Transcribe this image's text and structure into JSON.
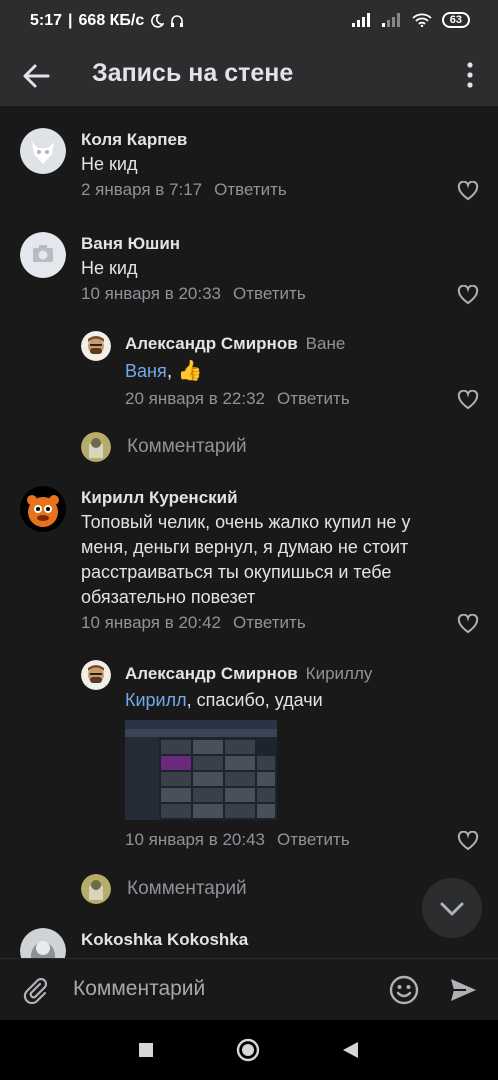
{
  "status_bar": {
    "time": "5:17",
    "speed": "668 КБ/с",
    "battery": "63"
  },
  "header": {
    "title": "Запись на стене"
  },
  "comments": [
    {
      "author": "Коля Карпев",
      "text": "Не кид",
      "date": "2 января в 7:17",
      "reply": "Ответить"
    },
    {
      "author": "Ваня Юшин",
      "text": "Не кид",
      "date": "10 января в 20:33",
      "reply": "Ответить"
    },
    {
      "author": "Александр Смирнов",
      "reply_to": "Ване",
      "mention": "Ваня",
      "text": ", 👍",
      "date": "20 января в 22:32",
      "reply": "Ответить"
    },
    {
      "author": "Кирилл Куренский",
      "text_lines": [
        "Топовый челик, очень жалко купил не у",
        "меня, деньги вернул, я думаю не стоит",
        "расстраиваться ты окупишься и тебе",
        "обязательно повезет"
      ],
      "date": "10 января в 20:42",
      "reply": "Ответить"
    },
    {
      "author": "Александр Смирнов",
      "reply_to": "Кириллу",
      "mention": "Кирилл",
      "text": ", спасибо, удачи",
      "date": "10 января в 20:43",
      "reply": "Ответить"
    },
    {
      "author": "Kokoshka Kokoshka"
    }
  ],
  "add_comment_placeholder": "Комментарий",
  "composer": {
    "placeholder": "Комментарий"
  },
  "colors": {
    "bg": "#19191a",
    "bar": "#2c2d2e",
    "link": "#71aaeb",
    "muted": "#8f9399"
  }
}
